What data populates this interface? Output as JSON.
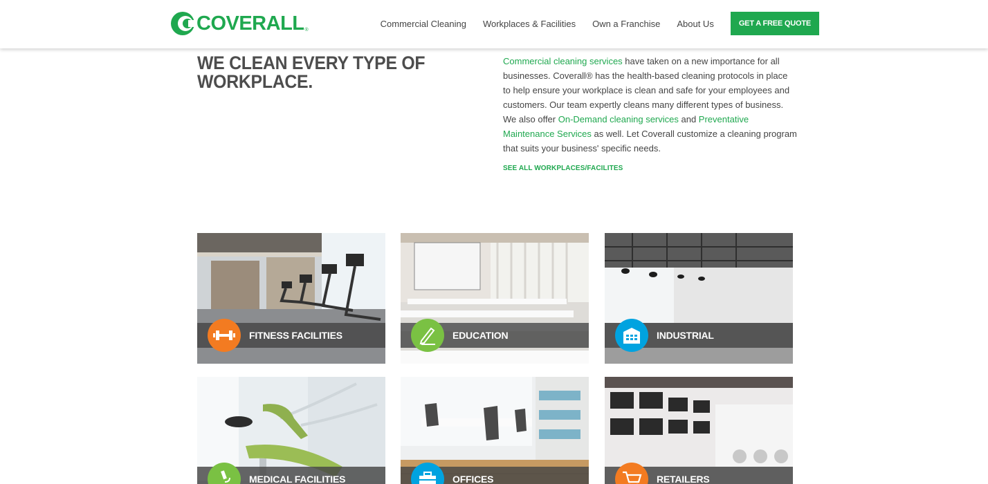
{
  "brand": {
    "name": "COVERALL",
    "reg": "®",
    "color": "#1fa84f"
  },
  "nav": {
    "items": [
      {
        "label": "Commercial Cleaning"
      },
      {
        "label": "Workplaces & Facilities"
      },
      {
        "label": "Own a Franchise"
      },
      {
        "label": "About Us"
      }
    ],
    "cta": "GET A FREE QUOTE"
  },
  "intro": {
    "headline_line1": "WE CLEAN EVERY TYPE OF",
    "headline_line2": "WORKPLACE.",
    "link1": "Commercial cleaning services",
    "text1": " have taken on a new importance for all businesses. Coverall® has the health-based cleaning protocols in place to help ensure your workplace is clean and safe for your employees and customers. Our team expertly cleans many different types of business. We also offer ",
    "link2": "On-Demand cleaning services",
    "text2": " and ",
    "link3": "Preventative Maintenance Services",
    "text3": " as well. Let Coverall customize a cleaning program that suits your business' specific needs.",
    "see_all": "SEE ALL WORKPLACES/FACILITES"
  },
  "tiles": [
    {
      "label": "FITNESS FACILITIES",
      "icon": "dumbbell-icon",
      "color": "#f37b21"
    },
    {
      "label": "EDUCATION",
      "icon": "pencil-paper-icon",
      "color": "#7ac143"
    },
    {
      "label": "INDUSTRIAL",
      "icon": "warehouse-icon",
      "color": "#00a3e0"
    },
    {
      "label": "MEDICAL FACILITIES",
      "icon": "microscope-icon",
      "color": "#7ac143"
    },
    {
      "label": "OFFICES",
      "icon": "briefcase-icon",
      "color": "#00a3e0"
    },
    {
      "label": "RETAILERS",
      "icon": "shopping-cart-icon",
      "color": "#f37b21"
    }
  ]
}
